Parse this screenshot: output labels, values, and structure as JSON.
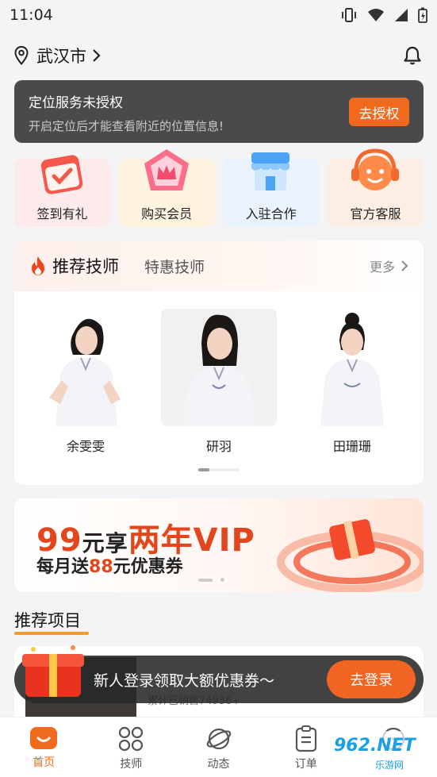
{
  "status_bar": {
    "time": "11:04"
  },
  "location": {
    "city": "武汉市"
  },
  "permission_banner": {
    "title": "定位服务未授权",
    "subtitle": "开启定位后才能查看附近的位置信息!",
    "button": "去授权"
  },
  "quick_actions": [
    {
      "label": "签到有礼",
      "bg": "#fdeaea"
    },
    {
      "label": "购买会员",
      "bg": "#fdf3df"
    },
    {
      "label": "入驻合作",
      "bg": "#e9f2fd"
    },
    {
      "label": "官方客服",
      "bg": "#fdeee4"
    }
  ],
  "technicians": {
    "tab_active": "推荐技师",
    "tab_other": "特惠技师",
    "more": "更多",
    "items": [
      {
        "name": "余雯雯"
      },
      {
        "name": "研羽"
      },
      {
        "name": "田珊珊"
      }
    ]
  },
  "vip_banner": {
    "price": "99",
    "price_unit": "元享",
    "offer": "两年VIP",
    "line2_prefix": "每月送",
    "line2_amount": "88",
    "line2_suffix": "元优惠券"
  },
  "section": {
    "title": "推荐项目"
  },
  "project": {
    "sales": "累计已销售74936+"
  },
  "promo": {
    "text": "新人登录领取大额优惠券～",
    "button": "去登录"
  },
  "tabbar": [
    {
      "label": "首页"
    },
    {
      "label": "技师"
    },
    {
      "label": "动态"
    },
    {
      "label": "订单"
    }
  ],
  "watermark": {
    "brand": "962.NET",
    "sub": "乐游网"
  },
  "colors": {
    "accent": "#f06a1e",
    "vip_red": "#e3461d"
  }
}
